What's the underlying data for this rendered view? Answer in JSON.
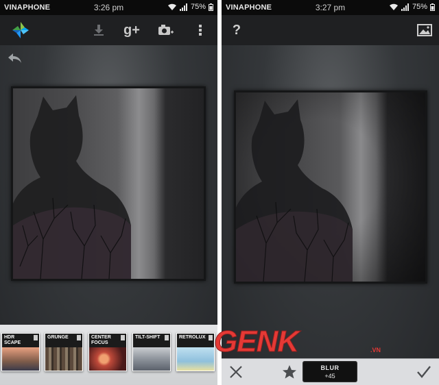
{
  "left_screen": {
    "status": {
      "carrier": "VINAPHONE",
      "time": "3:26 pm",
      "battery": "75%"
    },
    "toolbar": {
      "app_icon": "snapseed-logo-icon",
      "actions": [
        "download-icon",
        "google-plus-icon",
        "camera-add-icon",
        "overflow-menu-icon"
      ],
      "gplus_label": "g+"
    },
    "filters": [
      {
        "label": "HDR SCAPE",
        "thumb_color": "#c88a6a"
      },
      {
        "label": "GRUNGE",
        "thumb_color": "#6a5a4a"
      },
      {
        "label": "CENTER FOCUS",
        "thumb_color": "#b04a3a"
      },
      {
        "label": "TILT-SHIFT",
        "thumb_color": "#9aa4b0"
      },
      {
        "label": "RETROLUX",
        "thumb_color": "#9fc9e0"
      }
    ]
  },
  "right_screen": {
    "status": {
      "carrier": "VINAPHONE",
      "time": "3:27 pm",
      "battery": "75%"
    },
    "toolbar": {
      "help_label": "?",
      "image_icon": "image-icon"
    },
    "bottom": {
      "cancel_icon": "close-icon",
      "favorite_icon": "star-icon",
      "filter_name": "BLUR",
      "filter_value": "+45",
      "apply_icon": "checkmark-icon"
    }
  },
  "watermark": {
    "text": "GENK",
    "suffix": ".VN"
  },
  "colors": {
    "watermark_red": "#e53935",
    "toolbar_bg": "#1f2022"
  }
}
